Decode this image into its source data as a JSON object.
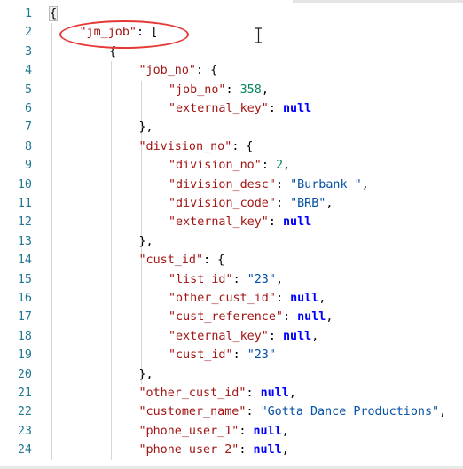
{
  "line_numbers": [
    "1",
    "2",
    "3",
    "4",
    "5",
    "6",
    "7",
    "8",
    "9",
    "10",
    "11",
    "12",
    "13",
    "14",
    "15",
    "16",
    "17",
    "18",
    "19",
    "20",
    "21",
    "22",
    "23",
    "24"
  ],
  "lines": [
    {
      "indent": 0,
      "tokens": [
        {
          "t": "punct",
          "v": "{"
        }
      ]
    },
    {
      "indent": 1,
      "tokens": [
        {
          "t": "key",
          "v": "\"jm_job\""
        },
        {
          "t": "punct",
          "v": ": ["
        }
      ]
    },
    {
      "indent": 2,
      "tokens": [
        {
          "t": "punct",
          "v": "{"
        }
      ]
    },
    {
      "indent": 3,
      "tokens": [
        {
          "t": "key",
          "v": "\"job_no\""
        },
        {
          "t": "punct",
          "v": ": {"
        }
      ]
    },
    {
      "indent": 4,
      "tokens": [
        {
          "t": "key",
          "v": "\"job_no\""
        },
        {
          "t": "punct",
          "v": ": "
        },
        {
          "t": "num",
          "v": "358"
        },
        {
          "t": "punct",
          "v": ","
        }
      ]
    },
    {
      "indent": 4,
      "tokens": [
        {
          "t": "key",
          "v": "\"external_key\""
        },
        {
          "t": "punct",
          "v": ": "
        },
        {
          "t": "kw",
          "v": "null"
        }
      ]
    },
    {
      "indent": 3,
      "tokens": [
        {
          "t": "punct",
          "v": "},"
        }
      ]
    },
    {
      "indent": 3,
      "tokens": [
        {
          "t": "key",
          "v": "\"division_no\""
        },
        {
          "t": "punct",
          "v": ": {"
        }
      ]
    },
    {
      "indent": 4,
      "tokens": [
        {
          "t": "key",
          "v": "\"division_no\""
        },
        {
          "t": "punct",
          "v": ": "
        },
        {
          "t": "num",
          "v": "2"
        },
        {
          "t": "punct",
          "v": ","
        }
      ]
    },
    {
      "indent": 4,
      "tokens": [
        {
          "t": "key",
          "v": "\"division_desc\""
        },
        {
          "t": "punct",
          "v": ": "
        },
        {
          "t": "str",
          "v": "\"Burbank \""
        },
        {
          "t": "punct",
          "v": ","
        }
      ]
    },
    {
      "indent": 4,
      "tokens": [
        {
          "t": "key",
          "v": "\"division_code\""
        },
        {
          "t": "punct",
          "v": ": "
        },
        {
          "t": "str",
          "v": "\"BRB\""
        },
        {
          "t": "punct",
          "v": ","
        }
      ]
    },
    {
      "indent": 4,
      "tokens": [
        {
          "t": "key",
          "v": "\"external_key\""
        },
        {
          "t": "punct",
          "v": ": "
        },
        {
          "t": "kw",
          "v": "null"
        }
      ]
    },
    {
      "indent": 3,
      "tokens": [
        {
          "t": "punct",
          "v": "},"
        }
      ]
    },
    {
      "indent": 3,
      "tokens": [
        {
          "t": "key",
          "v": "\"cust_id\""
        },
        {
          "t": "punct",
          "v": ": {"
        }
      ]
    },
    {
      "indent": 4,
      "tokens": [
        {
          "t": "key",
          "v": "\"list_id\""
        },
        {
          "t": "punct",
          "v": ": "
        },
        {
          "t": "str",
          "v": "\"23\""
        },
        {
          "t": "punct",
          "v": ","
        }
      ]
    },
    {
      "indent": 4,
      "tokens": [
        {
          "t": "key",
          "v": "\"other_cust_id\""
        },
        {
          "t": "punct",
          "v": ": "
        },
        {
          "t": "kw",
          "v": "null"
        },
        {
          "t": "punct",
          "v": ","
        }
      ]
    },
    {
      "indent": 4,
      "tokens": [
        {
          "t": "key",
          "v": "\"cust_reference\""
        },
        {
          "t": "punct",
          "v": ": "
        },
        {
          "t": "kw",
          "v": "null"
        },
        {
          "t": "punct",
          "v": ","
        }
      ]
    },
    {
      "indent": 4,
      "tokens": [
        {
          "t": "key",
          "v": "\"external_key\""
        },
        {
          "t": "punct",
          "v": ": "
        },
        {
          "t": "kw",
          "v": "null"
        },
        {
          "t": "punct",
          "v": ","
        }
      ]
    },
    {
      "indent": 4,
      "tokens": [
        {
          "t": "key",
          "v": "\"cust_id\""
        },
        {
          "t": "punct",
          "v": ": "
        },
        {
          "t": "str",
          "v": "\"23\""
        }
      ]
    },
    {
      "indent": 3,
      "tokens": [
        {
          "t": "punct",
          "v": "},"
        }
      ]
    },
    {
      "indent": 3,
      "tokens": [
        {
          "t": "key",
          "v": "\"other_cust_id\""
        },
        {
          "t": "punct",
          "v": ": "
        },
        {
          "t": "kw",
          "v": "null"
        },
        {
          "t": "punct",
          "v": ","
        }
      ]
    },
    {
      "indent": 3,
      "tokens": [
        {
          "t": "key",
          "v": "\"customer_name\""
        },
        {
          "t": "punct",
          "v": ": "
        },
        {
          "t": "str",
          "v": "\"Gotta Dance Productions\""
        },
        {
          "t": "punct",
          "v": ","
        }
      ]
    },
    {
      "indent": 3,
      "tokens": [
        {
          "t": "key",
          "v": "\"phone_user_1\""
        },
        {
          "t": "punct",
          "v": ": "
        },
        {
          "t": "kw",
          "v": "null"
        },
        {
          "t": "punct",
          "v": ","
        }
      ]
    },
    {
      "indent": 3,
      "tokens": [
        {
          "t": "key",
          "v": "\"phone user 2\""
        },
        {
          "t": "punct",
          "v": ": "
        },
        {
          "t": "kw",
          "v": "null"
        },
        {
          "t": "punct",
          "v": ","
        }
      ]
    }
  ],
  "colors": {
    "key": "#a31515",
    "string": "#0451a5",
    "number": "#098658",
    "keyword": "#0000ff",
    "line_number": "#237893",
    "annotation": "#e53935"
  },
  "icons": {
    "cursor": "text-cursor-icon"
  }
}
